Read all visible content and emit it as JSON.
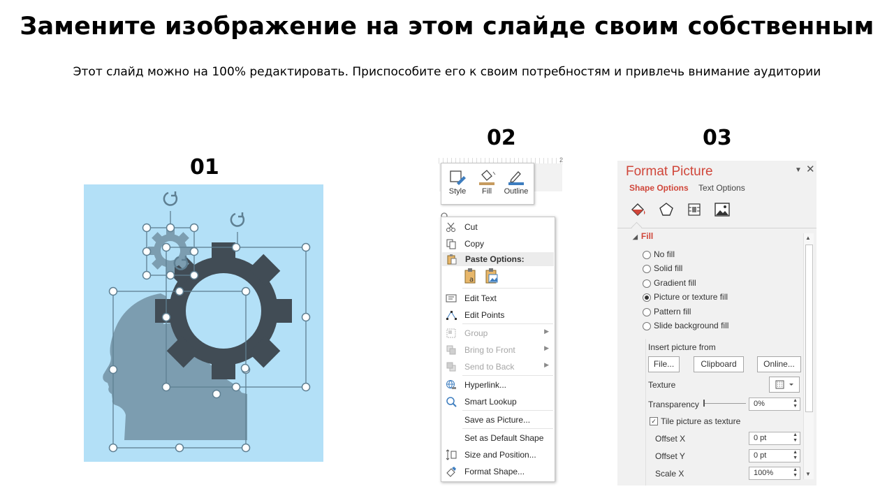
{
  "slide": {
    "title": "Замените изображение на этом слайде своим собственным",
    "subtitle": "Этот слайд можно на 100% редактировать. Приспособите его к своим потребностям и привлечь внимание аудитории",
    "step1": "01",
    "step2": "02",
    "step3": "03"
  },
  "colors": {
    "panel_bg": "#b3e0f7",
    "head": "#7c9db0",
    "gear": "#414c55",
    "handle": "#5e7f92",
    "accent": "#d0463a"
  },
  "minibar": {
    "ruler_mark": "2",
    "style": "Style",
    "fill": "Fill",
    "outline": "Outline"
  },
  "context_menu": {
    "cut": "Cut",
    "copy": "Copy",
    "paste_options": "Paste Options:",
    "edit_text": "Edit Text",
    "edit_points": "Edit Points",
    "group": "Group",
    "bring_to_front": "Bring to Front",
    "send_to_back": "Send to Back",
    "hyperlink": "Hyperlink...",
    "smart_lookup": "Smart Lookup",
    "save_as_picture": "Save as Picture...",
    "set_default_shape": "Set as Default Shape",
    "size_and_position": "Size and Position...",
    "format_shape": "Format Shape..."
  },
  "format_pane": {
    "title": "Format Picture",
    "tab_shape": "Shape Options",
    "tab_text": "Text Options",
    "fill_header": "Fill",
    "fill_options": [
      "No fill",
      "Solid fill",
      "Gradient fill",
      "Picture or texture fill",
      "Pattern fill",
      "Slide background fill"
    ],
    "selected_fill": 3,
    "insert_from": "Insert picture from",
    "file_btn": "File...",
    "clipboard_btn": "Clipboard",
    "online_btn": "Online...",
    "texture": "Texture",
    "transparency": "Transparency",
    "transparency_value": "0%",
    "tile": "Tile picture as texture",
    "offset_x": "Offset X",
    "offset_x_value": "0 pt",
    "offset_y": "Offset Y",
    "offset_y_value": "0 pt",
    "scale_x": "Scale X",
    "scale_x_value": "100%"
  }
}
